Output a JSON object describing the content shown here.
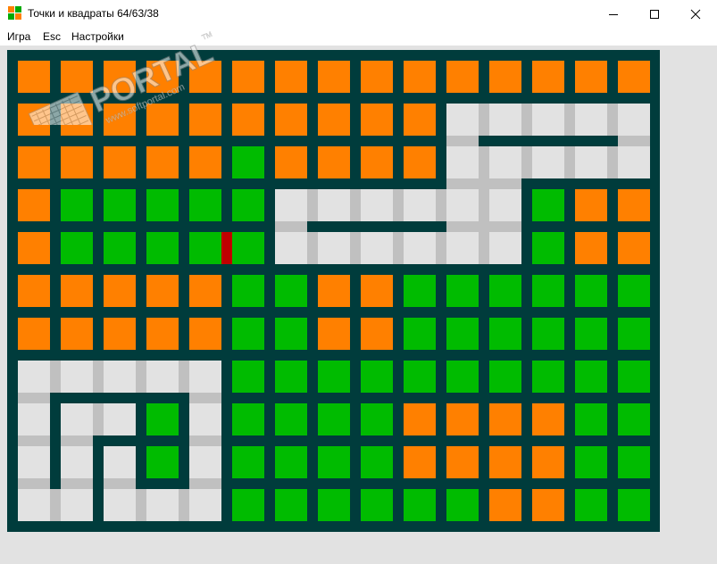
{
  "window": {
    "title": "Точки и квадраты 64/63/38",
    "minimize_icon": "minimize-icon",
    "maximize_icon": "maximize-icon",
    "close_icon": "close-icon"
  },
  "menu": {
    "items": [
      {
        "label": "Игра"
      },
      {
        "label": "Esc"
      },
      {
        "label": "Настройки"
      }
    ]
  },
  "watermark": {
    "brand": "PORTAL",
    "url": "www.softportal.com",
    "tm": "TM"
  },
  "colors": {
    "orange": "#ff8000",
    "green": "#00bb00",
    "red": "#c00000",
    "empty": "#e2e2e2",
    "board": "#003c3c",
    "empty_line": "#c0c0c0"
  },
  "board": {
    "cols": 15,
    "rows": 11,
    "legend": "O = orange box, G = green box, . = empty area",
    "grid": [
      "OOOOOOOOOOOOOOO",
      "OOOOOOOOOO.....",
      "OOOOOGOOOO.....",
      "OGGGGG......GOO",
      "OGGGGG......GOO",
      "OOOOOGGOOGGGGGG",
      "OOOOOGGOOGGGGGG",
      ".....GGGGGGGGGG",
      "...G.GGGGOOOOGG",
      "...G.GGGGOOOOGG",
      ".....GGGGGGOOGG"
    ],
    "last_move": {
      "row": 4,
      "col": 5,
      "side": "left",
      "color": "red"
    }
  }
}
